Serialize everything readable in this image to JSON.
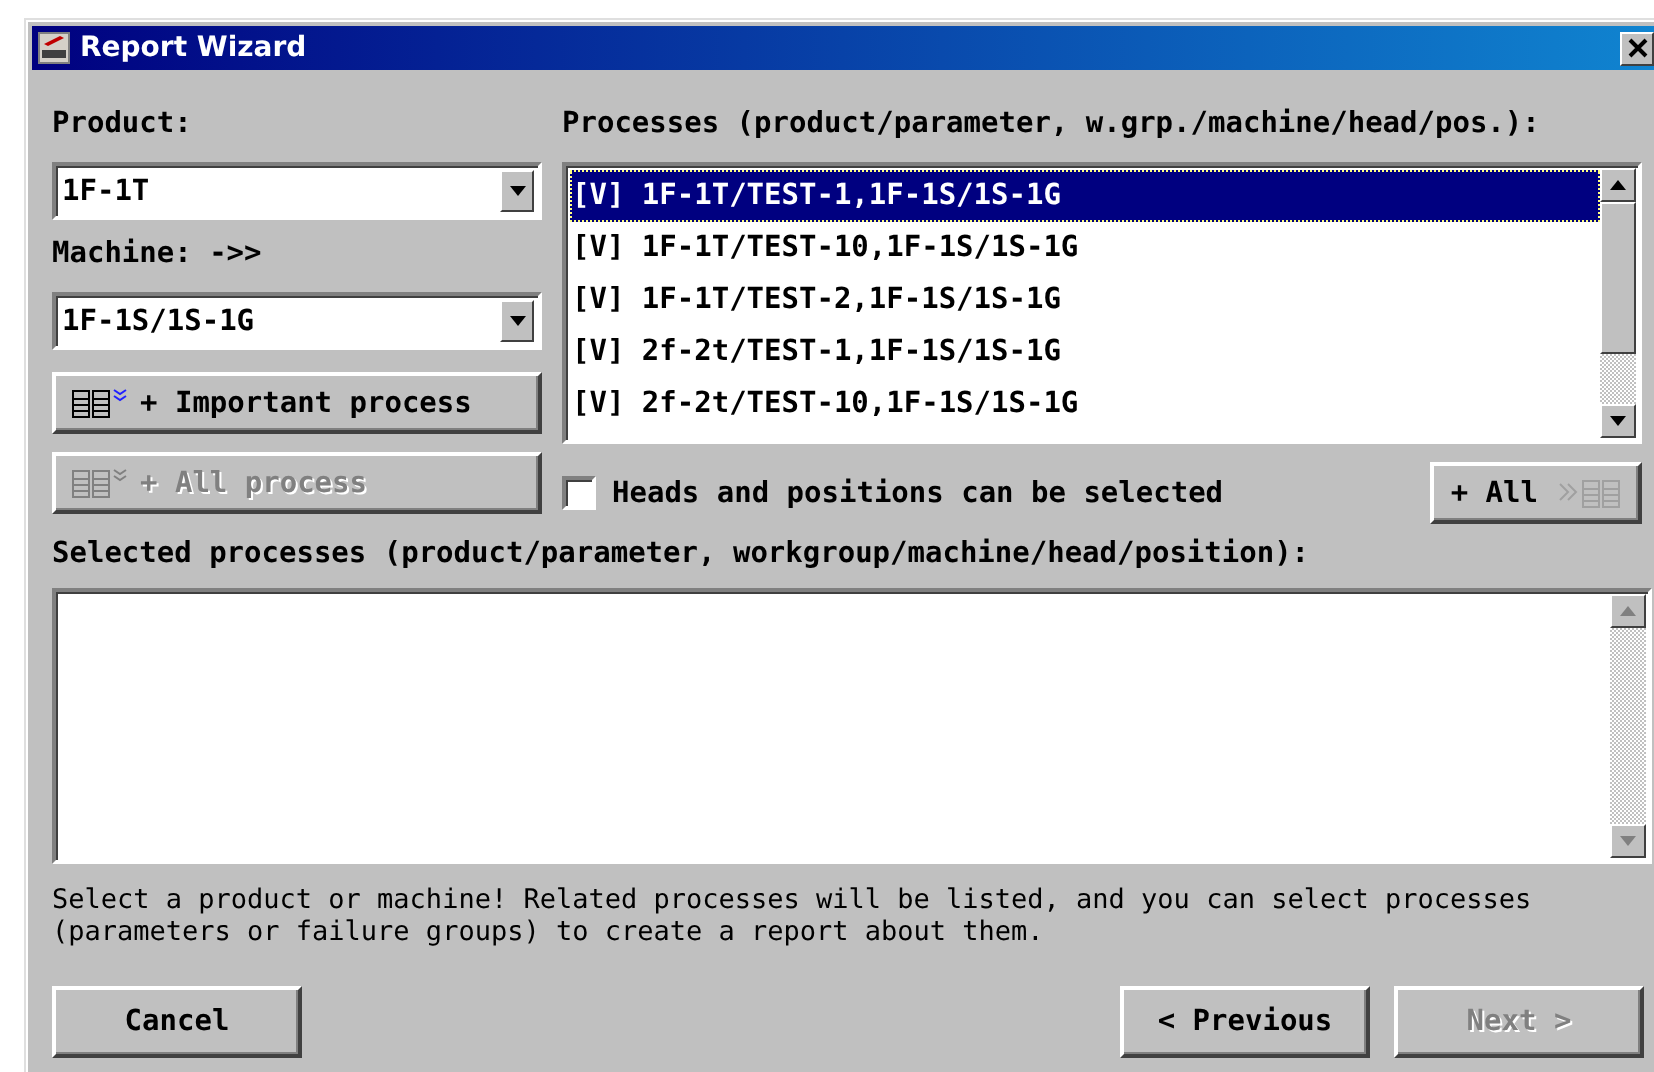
{
  "window": {
    "title": "Report Wizard"
  },
  "product": {
    "label": "Product:",
    "value": "1F-1T"
  },
  "machine": {
    "label": "Machine: ->>",
    "value": "1F-1S/1S-1G"
  },
  "important_button": {
    "label": "+ Important process",
    "disabled": false
  },
  "all_process_button": {
    "label": "+ All process",
    "disabled": true
  },
  "processes": {
    "label": "Processes (product/parameter, w.grp./machine/head/pos.):",
    "items": [
      {
        "text": "[V] 1F-1T/TEST-1,1F-1S/1S-1G",
        "selected": true
      },
      {
        "text": "[V] 1F-1T/TEST-10,1F-1S/1S-1G",
        "selected": false
      },
      {
        "text": "[V] 1F-1T/TEST-2,1F-1S/1S-1G",
        "selected": false
      },
      {
        "text": "[V] 2f-2t/TEST-1,1F-1S/1S-1G",
        "selected": false
      },
      {
        "text": "[V] 2f-2t/TEST-10,1F-1S/1S-1G",
        "selected": false
      }
    ]
  },
  "heads_checkbox": {
    "label": "Heads and positions can be selected",
    "checked": false
  },
  "add_all_button": {
    "label": "+ All",
    "disabled": false
  },
  "selected_processes": {
    "label": "Selected processes (product/parameter, workgroup/machine/head/position):"
  },
  "help_text": "Select a product or machine! Related processes will be listed, and you can select processes (parameters or failure groups) to create a report about them.",
  "buttons": [
    {
      "label": "Cancel",
      "kind": "cancel",
      "disabled": false
    },
    {
      "label": "< Previous",
      "kind": "previous",
      "disabled": false
    },
    {
      "label": "Next >",
      "kind": "next",
      "disabled": true
    }
  ]
}
